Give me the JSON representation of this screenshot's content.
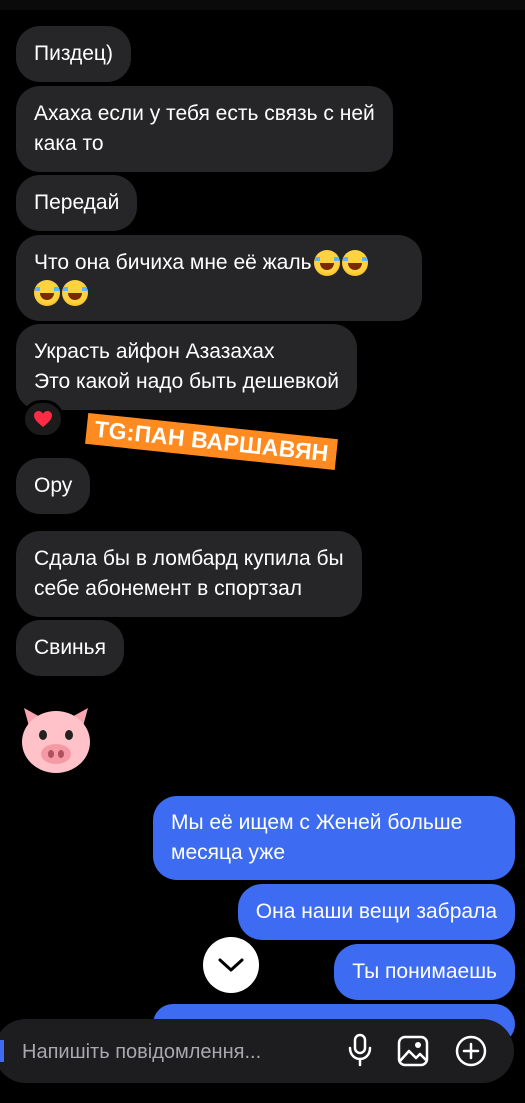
{
  "messages": [
    {
      "side": "in",
      "text": "Пиздец)"
    },
    {
      "side": "in",
      "lines": [
        "Ахаха если у тебя есть связь с ней",
        "кака то"
      ]
    },
    {
      "side": "in",
      "text": "Передай"
    },
    {
      "side": "in",
      "lines": [
        "Что она бичиха мне её жаль",
        ""
      ],
      "emoji": "face-with-tears-of-joy",
      "emoji_count_line1": 2,
      "emoji_count_line2": 2
    },
    {
      "side": "in",
      "lines": [
        "Украсть айфон Азазахах",
        "Это какой надо быть дешевкой"
      ],
      "reaction": "❤️"
    },
    {
      "side": "in",
      "text": "Ору"
    },
    {
      "side": "in",
      "lines": [
        "Сдала бы в ломбард купила  бы",
        "себе абонемент в спортзал"
      ]
    },
    {
      "side": "in",
      "text": "Свинья"
    },
    {
      "side": "in",
      "sticker_icon": "pig-face-icon"
    },
    {
      "side": "out",
      "lines": [
        "Мы её ищем с Женей больше",
        "месяца уже"
      ]
    },
    {
      "side": "out",
      "text": "Она наши вещи забрала"
    },
    {
      "side": "out",
      "text": "Ты понимаешь"
    }
  ],
  "watermark": "TG:ПАН ВАРШАВЯН",
  "composer": {
    "placeholder": "Напишіть повідомлення...",
    "icons": [
      "microphone-icon",
      "gallery-icon",
      "add-icon"
    ]
  },
  "scroll_button_icon": "chevron-down-icon",
  "colors": {
    "incoming": "#262628",
    "outgoing": "#3d6cf2",
    "sticker": "#ff8a1f",
    "background": "#000000"
  }
}
